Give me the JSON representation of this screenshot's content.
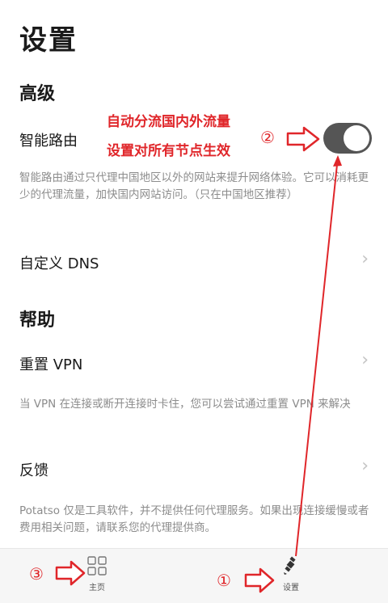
{
  "page": {
    "title": "设置"
  },
  "advanced": {
    "section_title": "高级",
    "smart_route": {
      "label": "智能路由",
      "enabled": true,
      "description": "智能路由通过只代理中国地区以外的网站来提升网络体验。它可以消耗更少的代理流量，加快国内网站访问。（只在中国地区推荐）"
    },
    "custom_dns": {
      "label": "自定义 DNS"
    }
  },
  "help": {
    "section_title": "帮助",
    "reset_vpn": {
      "label": "重置 VPN",
      "description": "当 VPN 在连接或断开连接时卡住，您可以尝试通过重置 VPN 来解决"
    },
    "feedback": {
      "label": "反馈"
    },
    "disclaimer": "Potatso 仅是工具软件，并不提供任何代理服务。如果出现连接缓慢或者费用相关问题，请联系您的代理提供商。"
  },
  "annotations": {
    "line1": "自动分流国内外流量",
    "line2": "设置对所有节点生效",
    "marker1": "①",
    "marker2": "②",
    "marker3": "③",
    "color": "#e0262a"
  },
  "tabbar": {
    "home_label": "主页",
    "settings_label": "设置",
    "home_icon": "grid-icon",
    "settings_icon": "satellite-icon"
  },
  "icons": {
    "chevron": "›"
  }
}
